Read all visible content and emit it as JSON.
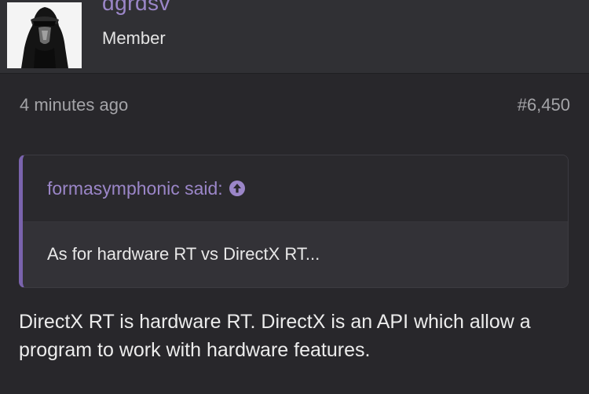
{
  "user": {
    "name": "dgrdsv",
    "title": "Member"
  },
  "post": {
    "time": "4 minutes ago",
    "number": "#6,450"
  },
  "quote": {
    "author_label": "formasymphonic said:",
    "text": "As for hardware RT vs DirectX RT..."
  },
  "message": {
    "text": "DirectX RT is hardware RT. DirectX is an API which allow a program to work with hardware features."
  },
  "colors": {
    "background": "#28272b",
    "header": "#303034",
    "accent": "#9b86c8",
    "quote_border": "#7a63ad",
    "muted_text": "#a4a4a8"
  },
  "icons": {
    "quote_jump": "arrow-up-circle-icon"
  }
}
